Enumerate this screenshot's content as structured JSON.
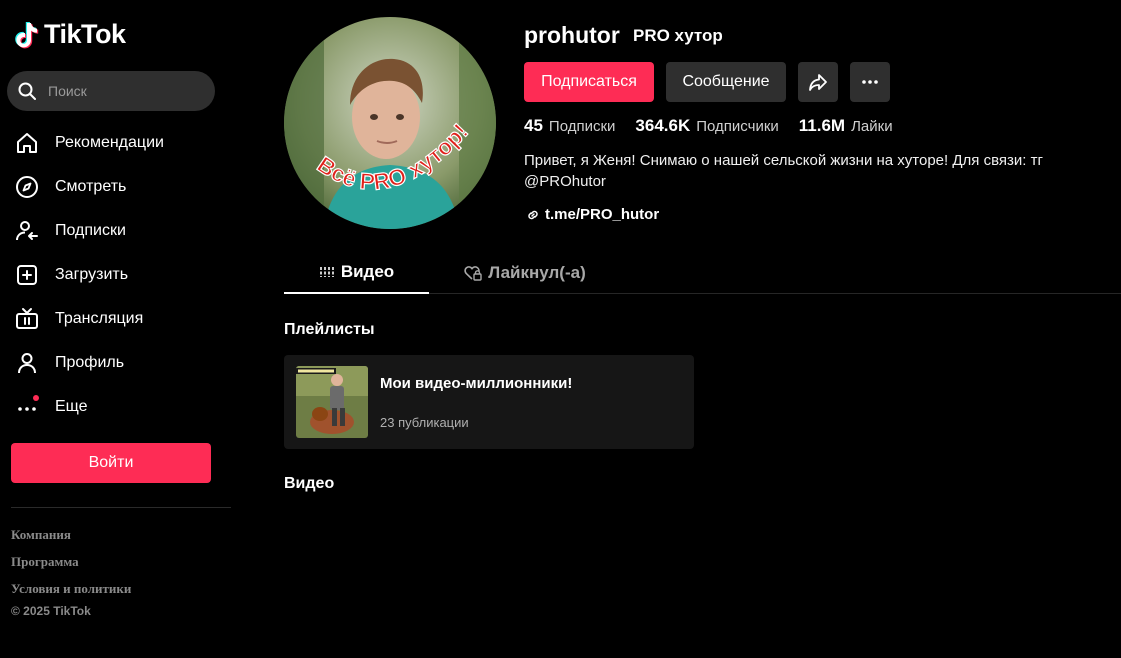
{
  "brand": {
    "name": "TikTok",
    "accent": "#fe2c55",
    "background": "#000000"
  },
  "search": {
    "placeholder": "Поиск",
    "icon": "search-icon"
  },
  "sidebar": {
    "items": [
      {
        "label": "Рекомендации",
        "icon": "home-icon"
      },
      {
        "label": "Смотреть",
        "icon": "compass-icon"
      },
      {
        "label": "Подписки",
        "icon": "following-icon"
      },
      {
        "label": "Загрузить",
        "icon": "upload-icon"
      },
      {
        "label": "Трансляция",
        "icon": "live-tv-icon"
      },
      {
        "label": "Профиль",
        "icon": "profile-icon"
      },
      {
        "label": "Еще",
        "icon": "more-icon"
      }
    ],
    "login_label": "Войти",
    "footer": [
      "Компания",
      "Программа",
      "Условия и политики"
    ],
    "copyright": "© 2025 TikTok"
  },
  "profile": {
    "username": "prohutor",
    "nickname": "PRO хутор",
    "avatar_text": "Всё PRO хутор!",
    "follow_label": "Подписаться",
    "message_label": "Сообщение",
    "stats": [
      {
        "value": "45",
        "label": "Подписки"
      },
      {
        "value": "364.6K",
        "label": "Подписчики"
      },
      {
        "value": "11.6M",
        "label": "Лайки"
      }
    ],
    "bio": "Привет, я Женя! Снимаю о нашей сельской жизни на хуторе! Для связи: тг @PROhutor",
    "link": "t.me/PRO_hutor"
  },
  "tabs": [
    {
      "label": "Видео",
      "icon": "grid-icon",
      "active": true
    },
    {
      "label": "Лайкнул(-а)",
      "icon": "heart-lock-icon",
      "active": false
    }
  ],
  "sections": {
    "playlists_title": "Плейлисты",
    "videos_title": "Видео"
  },
  "playlist": {
    "title": "Мои видео-миллионники!",
    "count": "23 публикации"
  }
}
